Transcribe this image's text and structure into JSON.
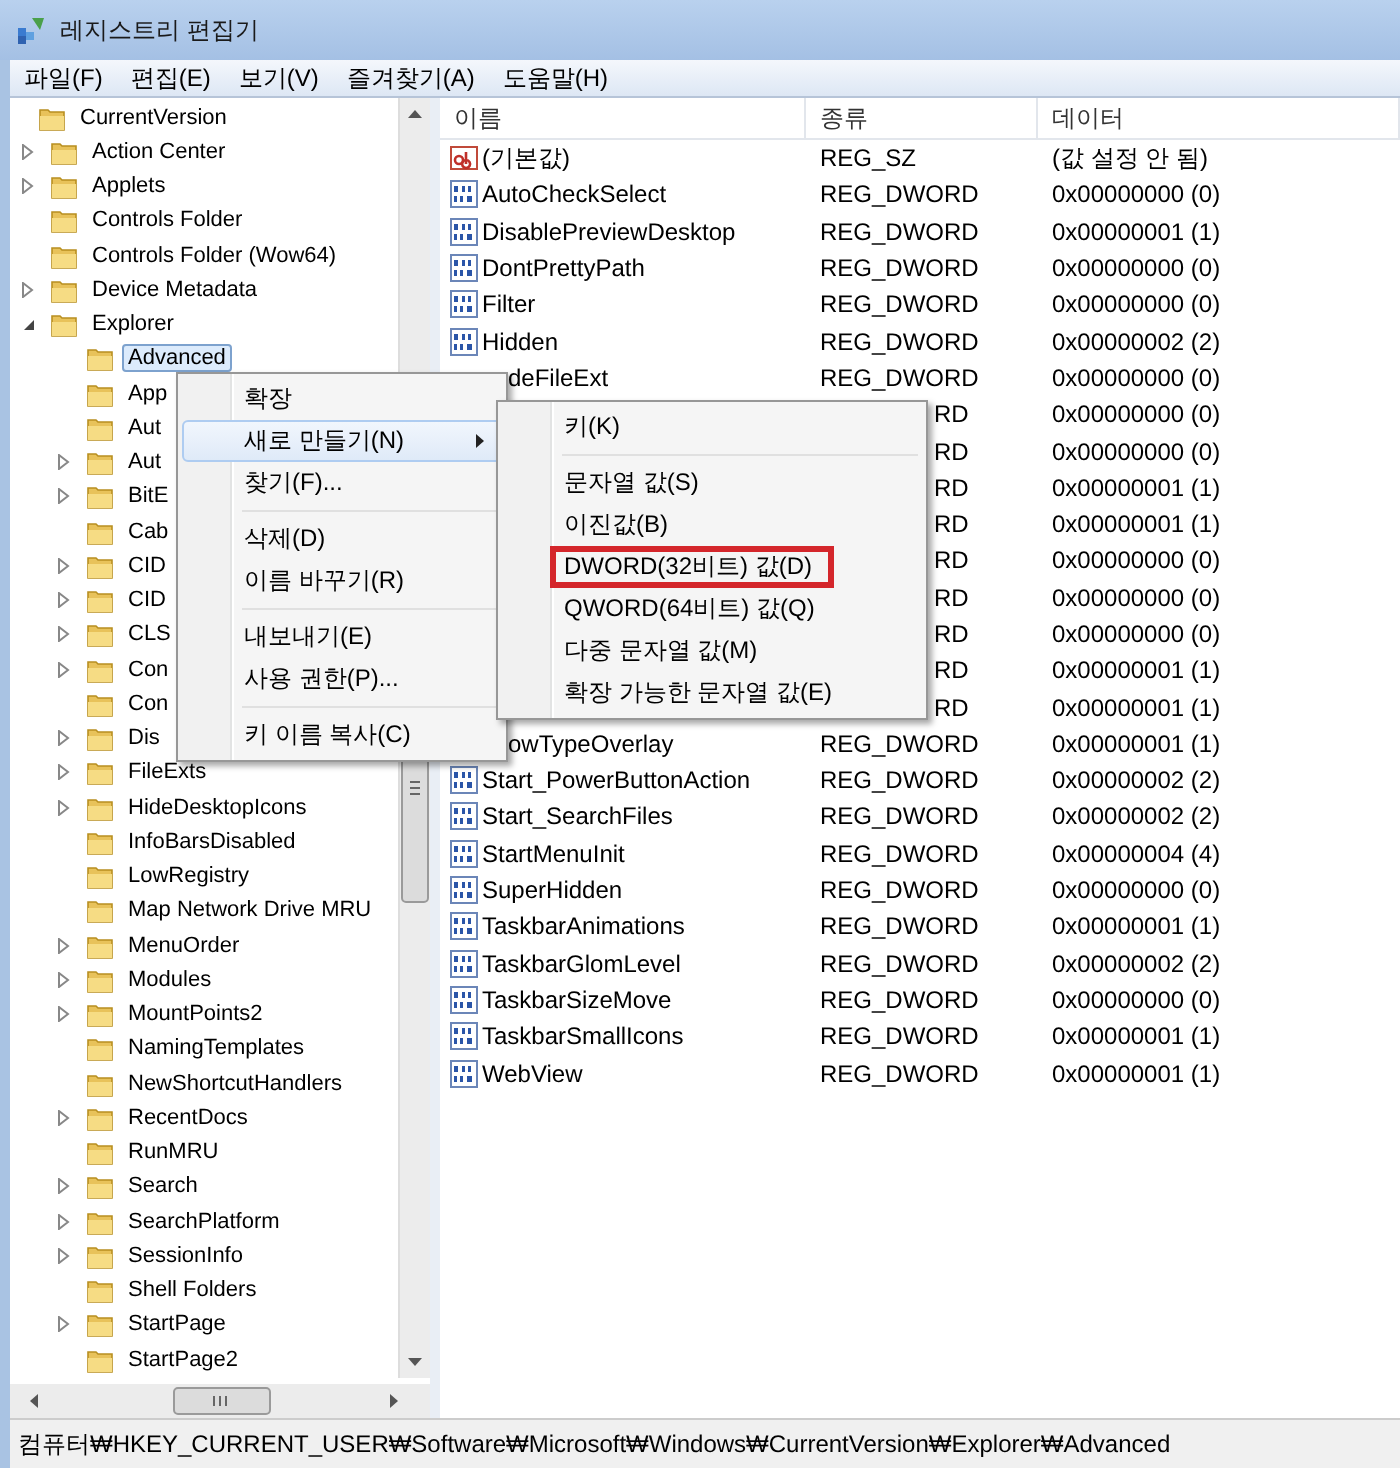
{
  "window": {
    "title": "레지스트리 편집기"
  },
  "menu_bar": [
    "파일(F)",
    "편집(E)",
    "보기(V)",
    "즐겨찾기(A)",
    "도움말(H)"
  ],
  "tree": {
    "items": [
      {
        "label": "CurrentVersion",
        "has_children": false,
        "expanded": false,
        "selected": false,
        "children": [
          {
            "label": "Action Center",
            "has_children": true,
            "expanded": false,
            "selected": false
          },
          {
            "label": "Applets",
            "has_children": true,
            "expanded": false,
            "selected": false
          },
          {
            "label": "Controls Folder",
            "has_children": false,
            "expanded": false,
            "selected": false
          },
          {
            "label": "Controls Folder (Wow64)",
            "has_children": false,
            "expanded": false,
            "selected": false
          },
          {
            "label": "Device Metadata",
            "has_children": true,
            "expanded": false,
            "selected": false
          },
          {
            "label": "Explorer",
            "has_children": true,
            "expanded": true,
            "selected": false,
            "children": [
              {
                "label": "Advanced",
                "has_children": false,
                "expanded": false,
                "selected": true
              },
              {
                "label": "App",
                "has_children": false,
                "expanded": false,
                "selected": false
              },
              {
                "label": "Aut",
                "has_children": false,
                "expanded": false,
                "selected": false
              },
              {
                "label": "Aut",
                "has_children": true,
                "expanded": false,
                "selected": false
              },
              {
                "label": "BitE",
                "has_children": true,
                "expanded": false,
                "selected": false
              },
              {
                "label": "Cab",
                "has_children": false,
                "expanded": false,
                "selected": false
              },
              {
                "label": "CID",
                "has_children": true,
                "expanded": false,
                "selected": false
              },
              {
                "label": "CID",
                "has_children": true,
                "expanded": false,
                "selected": false
              },
              {
                "label": "CLS",
                "has_children": true,
                "expanded": false,
                "selected": false
              },
              {
                "label": "Con",
                "has_children": true,
                "expanded": false,
                "selected": false
              },
              {
                "label": "Con",
                "has_children": false,
                "expanded": false,
                "selected": false
              },
              {
                "label": "Dis",
                "has_children": true,
                "expanded": false,
                "selected": false
              },
              {
                "label": "FileExts",
                "has_children": true,
                "expanded": false,
                "selected": false
              },
              {
                "label": "HideDesktopIcons",
                "has_children": true,
                "expanded": false,
                "selected": false
              },
              {
                "label": "InfoBarsDisabled",
                "has_children": false,
                "expanded": false,
                "selected": false
              },
              {
                "label": "LowRegistry",
                "has_children": false,
                "expanded": false,
                "selected": false
              },
              {
                "label": "Map Network Drive MRU",
                "has_children": false,
                "expanded": false,
                "selected": false
              },
              {
                "label": "MenuOrder",
                "has_children": true,
                "expanded": false,
                "selected": false
              },
              {
                "label": "Modules",
                "has_children": true,
                "expanded": false,
                "selected": false
              },
              {
                "label": "MountPoints2",
                "has_children": true,
                "expanded": false,
                "selected": false
              },
              {
                "label": "NamingTemplates",
                "has_children": false,
                "expanded": false,
                "selected": false
              },
              {
                "label": "NewShortcutHandlers",
                "has_children": false,
                "expanded": false,
                "selected": false
              },
              {
                "label": "RecentDocs",
                "has_children": true,
                "expanded": false,
                "selected": false
              },
              {
                "label": "RunMRU",
                "has_children": false,
                "expanded": false,
                "selected": false
              },
              {
                "label": "Search",
                "has_children": true,
                "expanded": false,
                "selected": false
              },
              {
                "label": "SearchPlatform",
                "has_children": true,
                "expanded": false,
                "selected": false
              },
              {
                "label": "SessionInfo",
                "has_children": true,
                "expanded": false,
                "selected": false
              },
              {
                "label": "Shell Folders",
                "has_children": false,
                "expanded": false,
                "selected": false
              },
              {
                "label": "StartPage",
                "has_children": true,
                "expanded": false,
                "selected": false
              },
              {
                "label": "StartPage2",
                "has_children": false,
                "expanded": false,
                "selected": false
              }
            ]
          }
        ]
      }
    ]
  },
  "table": {
    "columns": [
      "이름",
      "종류",
      "데이터"
    ],
    "rows": [
      {
        "kind": "sz",
        "name": "(기본값)",
        "type": "REG_SZ",
        "data": "(값 설정 안 됨)"
      },
      {
        "kind": "dword",
        "name": "AutoCheckSelect",
        "type": "REG_DWORD",
        "data": "0x00000000 (0)"
      },
      {
        "kind": "dword",
        "name": "DisablePreviewDesktop",
        "type": "REG_DWORD",
        "data": "0x00000001 (1)"
      },
      {
        "kind": "dword",
        "name": "DontPrettyPath",
        "type": "REG_DWORD",
        "data": "0x00000000 (0)"
      },
      {
        "kind": "dword",
        "name": "Filter",
        "type": "REG_DWORD",
        "data": "0x00000000 (0)"
      },
      {
        "kind": "dword",
        "name": "Hidden",
        "type": "REG_DWORD",
        "data": "0x00000002 (2)"
      },
      {
        "kind": "partial",
        "name": "deFileExt",
        "type": "REG_DWORD",
        "data": "0x00000000 (0)"
      },
      {
        "kind": "covered",
        "type": "RD",
        "data": "0x00000000 (0)"
      },
      {
        "kind": "covered",
        "type": "RD",
        "data": "0x00000000 (0)"
      },
      {
        "kind": "covered",
        "type": "RD",
        "data": "0x00000001 (1)"
      },
      {
        "kind": "covered",
        "type": "RD",
        "data": "0x00000001 (1)"
      },
      {
        "kind": "covered",
        "type": "RD",
        "data": "0x00000000 (0)"
      },
      {
        "kind": "covered",
        "type": "RD",
        "data": "0x00000000 (0)"
      },
      {
        "kind": "covered",
        "type": "RD",
        "data": "0x00000000 (0)"
      },
      {
        "kind": "covered",
        "type": "RD",
        "data": "0x00000001 (1)"
      },
      {
        "kind": "covered",
        "type": "RD",
        "data": "0x00000001 (1)"
      },
      {
        "kind": "partial",
        "name": "owTypeOverlay",
        "type": "REG_DWORD",
        "data": "0x00000001 (1)"
      },
      {
        "kind": "dword",
        "name": "Start_PowerButtonAction",
        "type": "REG_DWORD",
        "data": "0x00000002 (2)"
      },
      {
        "kind": "dword",
        "name": "Start_SearchFiles",
        "type": "REG_DWORD",
        "data": "0x00000002 (2)"
      },
      {
        "kind": "dword",
        "name": "StartMenuInit",
        "type": "REG_DWORD",
        "data": "0x00000004 (4)"
      },
      {
        "kind": "dword",
        "name": "SuperHidden",
        "type": "REG_DWORD",
        "data": "0x00000000 (0)"
      },
      {
        "kind": "dword",
        "name": "TaskbarAnimations",
        "type": "REG_DWORD",
        "data": "0x00000001 (1)"
      },
      {
        "kind": "dword",
        "name": "TaskbarGlomLevel",
        "type": "REG_DWORD",
        "data": "0x00000002 (2)"
      },
      {
        "kind": "dword",
        "name": "TaskbarSizeMove",
        "type": "REG_DWORD",
        "data": "0x00000000 (0)"
      },
      {
        "kind": "dword",
        "name": "TaskbarSmallIcons",
        "type": "REG_DWORD",
        "data": "0x00000001 (1)"
      },
      {
        "kind": "dword",
        "name": "WebView",
        "type": "REG_DWORD",
        "data": "0x00000001 (1)"
      }
    ]
  },
  "context_menu": {
    "items": [
      {
        "kind": "item",
        "label": "확장",
        "selected": false,
        "submenu": false
      },
      {
        "kind": "item",
        "label": "새로 만들기(N)",
        "selected": true,
        "submenu": true
      },
      {
        "kind": "item",
        "label": "찾기(F)...",
        "selected": false,
        "submenu": false
      },
      {
        "kind": "separator"
      },
      {
        "kind": "item",
        "label": "삭제(D)",
        "selected": false,
        "submenu": false
      },
      {
        "kind": "item",
        "label": "이름 바꾸기(R)",
        "selected": false,
        "submenu": false
      },
      {
        "kind": "separator"
      },
      {
        "kind": "item",
        "label": "내보내기(E)",
        "selected": false,
        "submenu": false
      },
      {
        "kind": "item",
        "label": "사용 권한(P)...",
        "selected": false,
        "submenu": false
      },
      {
        "kind": "separator"
      },
      {
        "kind": "item",
        "label": "키 이름 복사(C)",
        "selected": false,
        "submenu": false
      }
    ]
  },
  "submenu": {
    "items": [
      {
        "kind": "item",
        "label": "키(K)",
        "highlighted_box": false
      },
      {
        "kind": "separator"
      },
      {
        "kind": "item",
        "label": "문자열 값(S)",
        "highlighted_box": false
      },
      {
        "kind": "item",
        "label": "이진값(B)",
        "highlighted_box": false
      },
      {
        "kind": "item",
        "label": "DWORD(32비트) 값(D)",
        "highlighted_box": true
      },
      {
        "kind": "item",
        "label": "QWORD(64비트) 값(Q)",
        "highlighted_box": false
      },
      {
        "kind": "item",
        "label": "다중 문자열 값(M)",
        "highlighted_box": false
      },
      {
        "kind": "item",
        "label": "확장 가능한 문자열 값(E)",
        "highlighted_box": false
      }
    ]
  },
  "status_bar": "컴퓨터₩HKEY_CURRENT_USER₩Software₩Microsoft₩Windows₩CurrentVersion₩Explorer₩Advanced"
}
